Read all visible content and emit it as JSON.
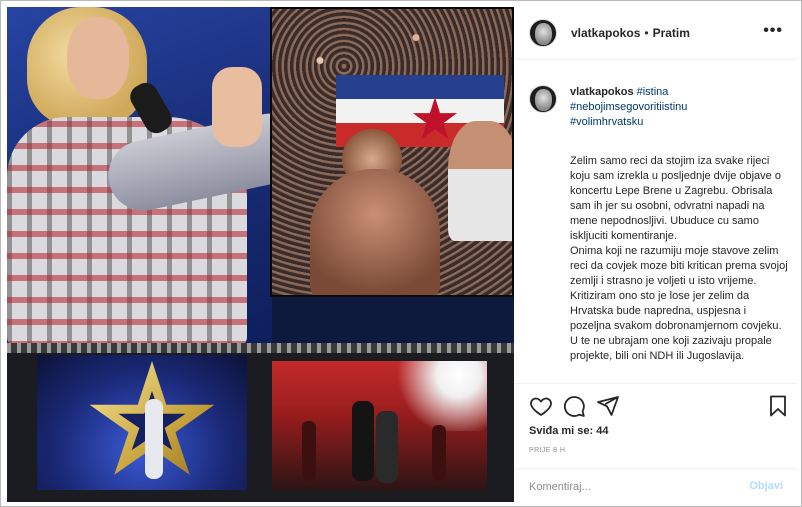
{
  "header": {
    "username": "vlatkapokos",
    "separator": "•",
    "follow_label": "Pratim",
    "more_icon": "more-options-icon"
  },
  "caption": {
    "username": "vlatkapokos",
    "hashtags": [
      "#istina",
      "#nebojimsegovoritiistinu",
      "#volimhrvatsku"
    ],
    "body": "Zelim samo reci da stojim iza svake rijeci koju sam izrekla u posljednje dvije objave o koncertu Lepe Brene u Zagrebu. Obrisala sam ih jer su osobni, odvratni napadi na mene nepodnosljivi. Ubuduce cu samo iskljuciti komentiranje.\nOnima koji ne razumiju moje stavove zelim reci da covjek moze biti kritican prema svojoj zemlji i strasno je voljeti u isto vrijeme. Kritiziram ono sto je lose jer zelim da Hrvatska bude napredna, uspjesna i pozeljna svakom dobronamjernom covjeku. U te ne ubrajam one koji zazivaju propale projekte, bili oni NDH ili Jugoslavija."
  },
  "actions": {
    "like_icon": "heart-icon",
    "comment_icon": "comment-icon",
    "share_icon": "paper-plane-icon",
    "save_icon": "bookmark-icon"
  },
  "likes": {
    "label": "Sviđa mi se:",
    "count": "44"
  },
  "timestamp": "PRIJE 8 H",
  "comment": {
    "placeholder": "Komentiraj...",
    "post_label": "Objavi"
  },
  "colors": {
    "text": "#262626",
    "link": "#00376b",
    "muted": "#8e8e8e",
    "post_disabled": "#b3dbff",
    "divider": "#efefef"
  }
}
